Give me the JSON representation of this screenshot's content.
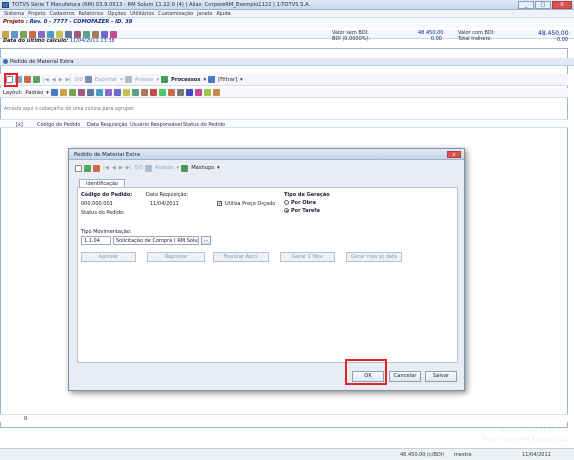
{
  "window": {
    "title": "TOTVS Série T Manufatura (RM) 03.9.0513 - RM Solum 11.22.0 (4) | Alias: CorporeRM_Exemplo1122 | 1-TOTVS S.A.",
    "controls": [
      "_",
      "□",
      "X"
    ]
  },
  "menu": [
    "Sistema",
    "Projeto",
    "Cadastros",
    "Relatórios",
    "Opções",
    "Utilitários",
    "Customização",
    "Janela",
    "Ajuda"
  ],
  "project": {
    "project_label": "Projeto",
    "project_value": ": Rev. 0 - 7777 - COMOFAZER - ID. 38",
    "date_label": "Data do último cálculo:",
    "date_value": "11/04/2011 13:38"
  },
  "bdi": {
    "valor_sem_bdi_label": "Valor sem BDI:",
    "valor_sem_bdi": "48.450,00",
    "bdi_label": "BDI (0,0000%):",
    "bdi_value": "0.00",
    "valor_com_bdi_label": "Valor com BDI:",
    "valor_com_bdi": "48.450,00",
    "total_indireto_label": "Total Indireto",
    "total_indireto": "0.00"
  },
  "subwindow": {
    "title": "Pedido de Material Extra"
  },
  "toolbar": {
    "counter": "0/0",
    "exportar": "Exportar",
    "anexos": "Anexos",
    "processos": "Processos",
    "filtrar": "[Filtrar]",
    "layout": "Layout:",
    "padrao": "Padrão"
  },
  "grid": {
    "group_hint": "Arraste aqui o cabeçalho de uma coluna para agrupar",
    "columns": [
      "[x]",
      "Código do Pedido",
      "Data Requisição",
      "Usuário Responsável",
      "Status do Pedido"
    ],
    "footer_count": "0"
  },
  "dialog": {
    "title": "Pedido de Material Extra",
    "counter": "0/0",
    "anexos": "Anexos",
    "mashups": "Mashups",
    "tab": "Identificação",
    "codigo_label": "Código do Pedido:",
    "codigo_value": "000.000.001",
    "data_label": "Data Requisição:",
    "data_value": "11/04/2011",
    "utiliza_preco": "Utiliza Preço Orçado",
    "status_label": "Status do Pedido:",
    "tipo_geracao_label": "Tipo de Geração",
    "por_obra": "Por Obra",
    "por_tarefa": "Por Tarefa",
    "tipo_mov_label": "Tipo Movimentação:",
    "tipo_mov_code": "1.1.04",
    "tipo_mov_desc": "Solicitação de Compra  ( RM Solum )",
    "lookup": "...",
    "buttons": [
      "Aprovar",
      "Reprovar",
      "Finalizar Apro.",
      "Gerar 1 Mov",
      "Gerar mov p/ data"
    ],
    "ok": "OK",
    "cancelar": "Cancelar",
    "salvar": "Salvar"
  },
  "watermark": {
    "line1": "Versão Oficial: 11.22.0 (4)",
    "line2": "Alias: CorporeRM_Exemplo1122"
  },
  "status": {
    "value": "48.450,00 (c/BDI)",
    "user": "mestre",
    "date": "11/04/2011"
  }
}
